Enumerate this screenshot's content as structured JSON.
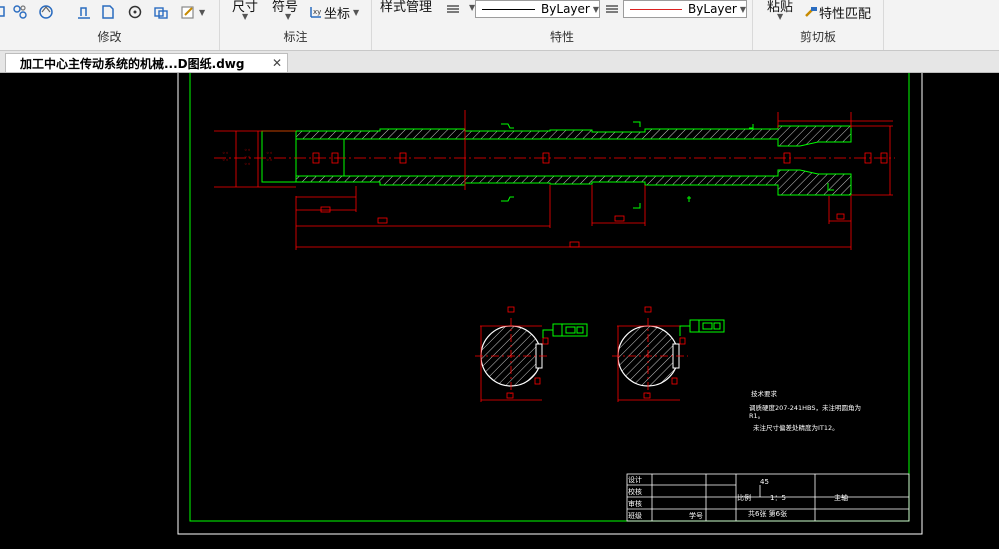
{
  "ribbon": {
    "groups": {
      "modify": "修改",
      "annotation": "标注",
      "properties": "特性",
      "clipboard": "剪切板"
    },
    "dimension_label": "尺寸",
    "symbol_label": "符号",
    "coordinate_label": "坐标",
    "style_manager_label": "样式管理",
    "linetype_value": "ByLayer",
    "color_value": "ByLayer",
    "paste_label": "粘贴",
    "match_properties_label": "特性匹配"
  },
  "document_tab": {
    "title": "加工中心主传动系统的机械...D图纸.dwg"
  },
  "drawing": {
    "tech_requirements": {
      "title": "技术要求",
      "line1": "调质硬度207-241HBS，未注明圆角为",
      "line2": "R1。",
      "line3": "未注尺寸偏差处精度为IT12。"
    },
    "title_block": {
      "design": "设计",
      "check": "校核",
      "review": "审核",
      "class": "班级",
      "student_no": "学号",
      "material": "45",
      "scale_label": "比例",
      "scale_value": "1：5",
      "part_name": "主轴",
      "sheets": "共6张 第6张"
    }
  },
  "colors": {
    "outline": "#00ff00",
    "dimension": "#ff0000",
    "frame": "#ffffff",
    "background": "#000000"
  }
}
